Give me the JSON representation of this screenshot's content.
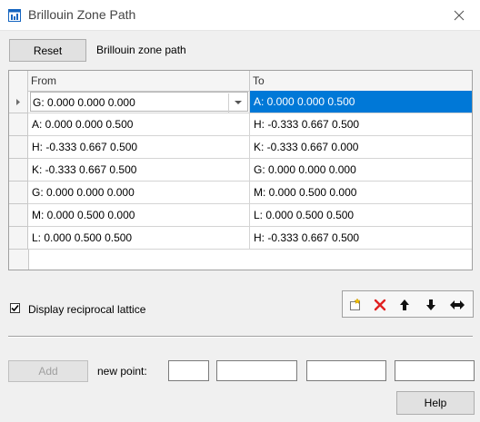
{
  "window": {
    "title": "Brillouin Zone Path",
    "title_color": "#444444"
  },
  "toolbar": {
    "reset_label": "Reset",
    "path_label": "Brillouin zone path"
  },
  "grid": {
    "columns": [
      "From",
      "To"
    ],
    "selection_color": "#0078d7",
    "rows": [
      {
        "from": "G:  0.000  0.000  0.000",
        "to": "A:  0.000  0.000  0.500"
      },
      {
        "from": "A:  0.000  0.000  0.500",
        "to": "H:  -0.333  0.667  0.500"
      },
      {
        "from": "H:  -0.333  0.667  0.500",
        "to": "K:  -0.333  0.667  0.000"
      },
      {
        "from": "K:  -0.333  0.667  0.500",
        "to": "G:  0.000  0.000  0.000"
      },
      {
        "from": "G:  0.000  0.000  0.000",
        "to": "M:  0.000  0.500  0.000"
      },
      {
        "from": "M:  0.000  0.500  0.000",
        "to": "L:  0.000  0.500  0.500"
      },
      {
        "from": "L:  0.000  0.500  0.500",
        "to": "H:  -0.333  0.667  0.500"
      }
    ]
  },
  "display_reciprocal": {
    "label": "Display reciprocal lattice",
    "checked": true
  },
  "tools": [
    "new-row-icon",
    "delete-icon",
    "move-up-icon",
    "move-down-icon",
    "reverse-icon"
  ],
  "add_label": "Add",
  "new_point_label": "new point:",
  "help_label": "Help"
}
